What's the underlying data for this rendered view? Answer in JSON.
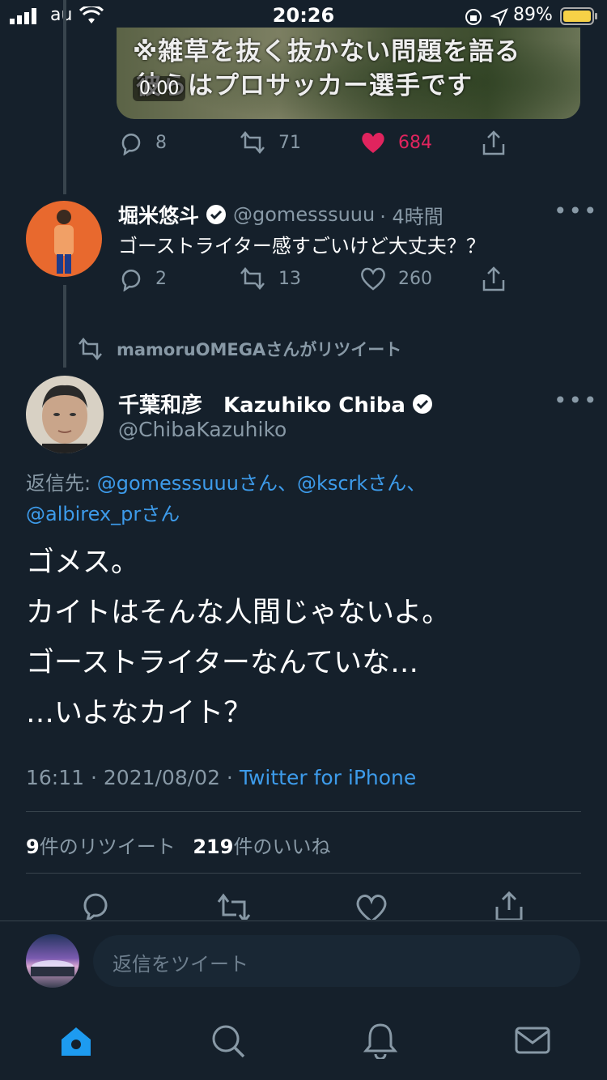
{
  "status_bar": {
    "carrier": "au",
    "time": "20:26",
    "battery": "89%"
  },
  "colors": {
    "background": "#15202b",
    "link": "#3d9bea",
    "like": "#e0245e",
    "secondary": "#8899a6"
  },
  "top_tweet": {
    "video_caption_line1": "※雑草を抜く抜かない問題を語る",
    "video_caption_line2": "彼らはプロサッカー選手です",
    "video_duration": "0:00",
    "replies": "8",
    "retweets": "71",
    "likes": "684"
  },
  "reply_tweet": {
    "name": "堀米悠斗",
    "handle": "@gomesssuuu",
    "time": "· 4時間",
    "text": "ゴーストライター感すごいけど大丈夫？？",
    "replies": "2",
    "retweets": "13",
    "likes": "260"
  },
  "retweet_context": "mamoruOMEGAさんがリツイート",
  "main_tweet": {
    "name": "千葉和彦　Kazuhiko Chiba",
    "handle": "@ChibaKazuhiko",
    "reply_to_label": "返信先:",
    "reply_to_line1": "@gomesssuuuさん、@kscrkさん、",
    "reply_to_line2": "@albirex_prさん",
    "lines": [
      "ゴメス。",
      "カイトはそんな人間じゃないよ。",
      "ゴーストライターなんていな…",
      "…いよなカイト？"
    ],
    "meta": "16:11 · 2021/08/02 · ",
    "source": "Twitter for iPhone",
    "retweet_count": "9",
    "retweet_label": "件のリツイート",
    "like_count": "219",
    "like_label": "件のいいね"
  },
  "composer": {
    "placeholder": "返信をツイート"
  },
  "tabs": [
    "home-icon",
    "search-icon",
    "bell-icon",
    "mail-icon"
  ]
}
